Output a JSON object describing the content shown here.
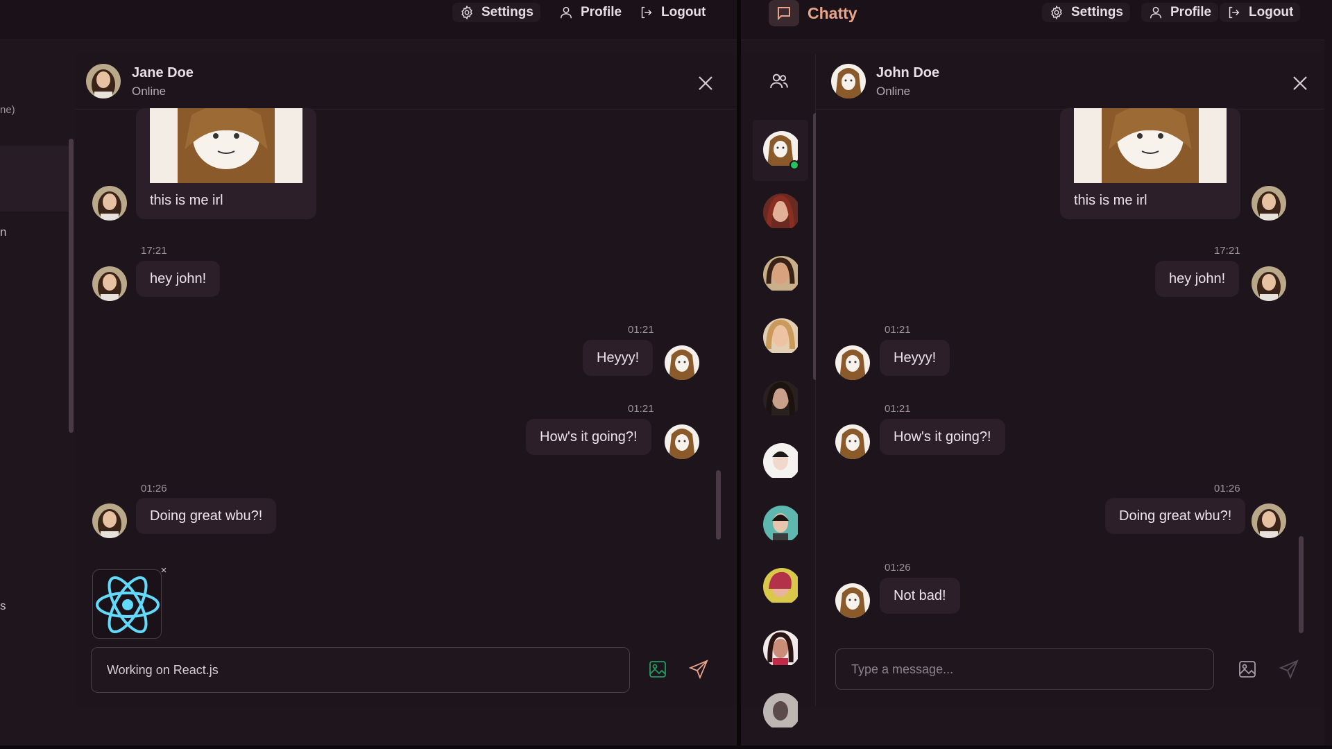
{
  "colors": {
    "accent": "#e8a58a",
    "background": "#1e151d",
    "bubble": "#2c1f2a",
    "online": "#22c55e",
    "react": "#61dafb"
  },
  "nav": {
    "brand": "Chatty",
    "settings": "Settings",
    "profile": "Profile",
    "logout": "Logout"
  },
  "left": {
    "partial_texts": [
      "ne)",
      "n",
      "s"
    ],
    "header": {
      "name": "Jane Doe",
      "status": "Online"
    },
    "messages": [
      {
        "side": "left",
        "type": "image",
        "caption": "this is me irl",
        "avatar": "jane"
      },
      {
        "side": "left",
        "time": "17:21",
        "text": "hey john!",
        "avatar": "jane"
      },
      {
        "side": "right",
        "time": "01:21",
        "text": "Heyyy!",
        "avatar": "john"
      },
      {
        "side": "right",
        "time": "01:21",
        "text": "How's it going?!",
        "avatar": "john"
      },
      {
        "side": "left",
        "time": "01:26",
        "text": "Doing great wbu?!",
        "avatar": "jane"
      }
    ],
    "attachment": {
      "icon": "react-logo-icon",
      "remove_label": "×"
    },
    "input": {
      "value": "Working on React.js",
      "placeholder": "Type a message..."
    }
  },
  "right": {
    "header": {
      "name": "John Doe",
      "status": "Online"
    },
    "messages": [
      {
        "side": "right",
        "type": "image",
        "caption": "this is me irl",
        "avatar": "jane"
      },
      {
        "side": "right",
        "time": "17:21",
        "text": "hey john!",
        "avatar": "jane"
      },
      {
        "side": "left",
        "time": "01:21",
        "text": "Heyyy!",
        "avatar": "john"
      },
      {
        "side": "left",
        "time": "01:21",
        "text": "How's it going?!",
        "avatar": "john"
      },
      {
        "side": "right",
        "time": "01:26",
        "text": "Doing great wbu?!",
        "avatar": "jane"
      },
      {
        "side": "left",
        "time": "01:26",
        "text": "Not bad!",
        "avatar": "john"
      }
    ],
    "input": {
      "value": "",
      "placeholder": "Type a message..."
    },
    "contacts": [
      {
        "avatar": "john",
        "online": true,
        "selected": true
      },
      {
        "avatar": "contact-2",
        "online": false
      },
      {
        "avatar": "contact-3",
        "online": false
      },
      {
        "avatar": "contact-4",
        "online": false
      },
      {
        "avatar": "contact-5",
        "online": false
      },
      {
        "avatar": "contact-6",
        "online": false
      },
      {
        "avatar": "contact-7",
        "online": false
      },
      {
        "avatar": "contact-8",
        "online": false
      },
      {
        "avatar": "contact-9",
        "online": false
      },
      {
        "avatar": "contact-10",
        "online": false
      }
    ]
  }
}
